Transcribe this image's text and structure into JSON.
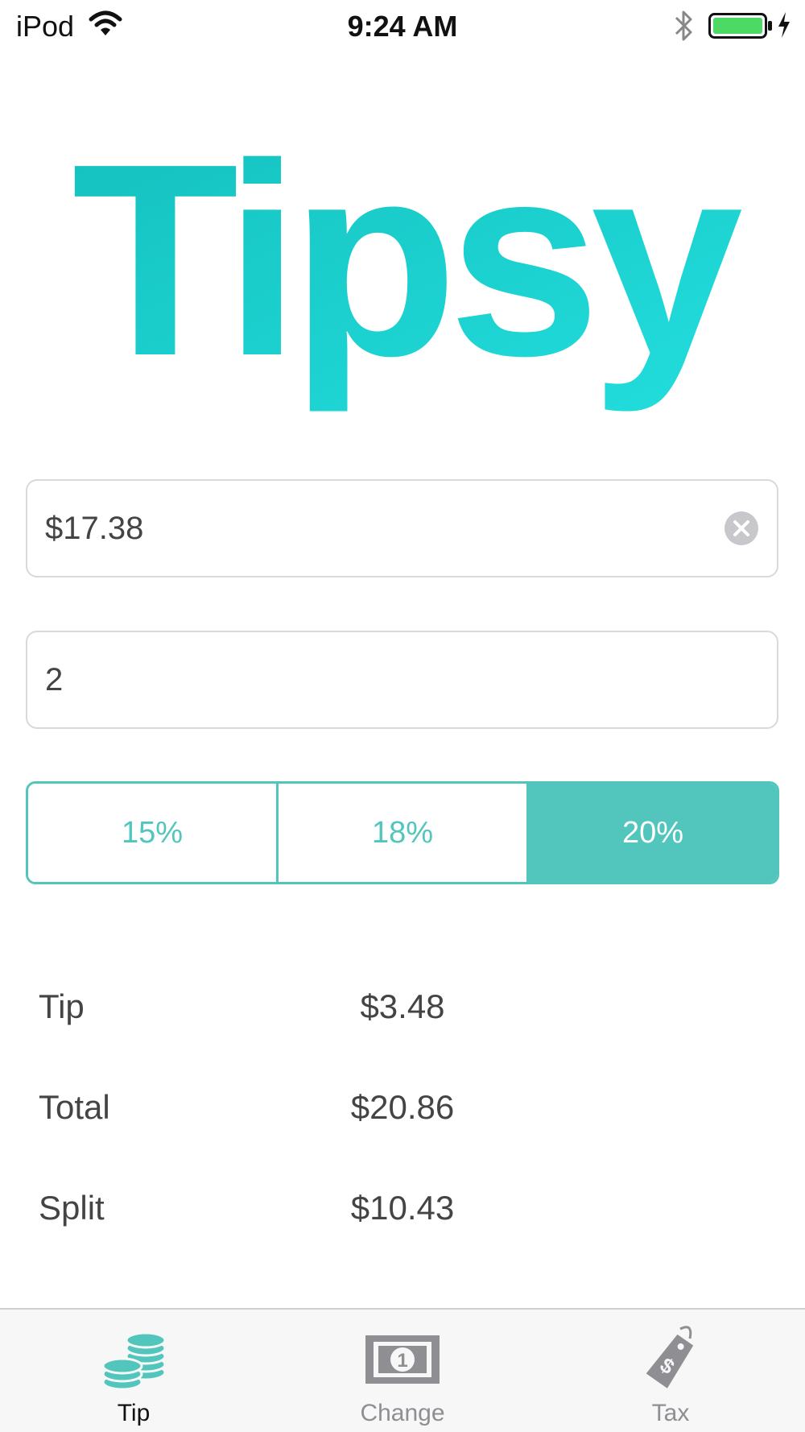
{
  "status_bar": {
    "carrier": "iPod",
    "time": "9:24 AM",
    "battery_color": "#4cd964"
  },
  "app": {
    "logo_text": "Tipsy",
    "logo_gradient": [
      "#14c0bd",
      "#22dede"
    ]
  },
  "bill_input": {
    "value": "$17.38",
    "has_clear_button": true
  },
  "split_input": {
    "value": "2"
  },
  "tip_selector": {
    "options": [
      "15%",
      "18%",
      "20%"
    ],
    "selected": "20%",
    "accent_color": "#52c6bd"
  },
  "results": [
    {
      "label": "Tip",
      "value": "$3.48"
    },
    {
      "label": "Total",
      "value": "$20.86"
    },
    {
      "label": "Split",
      "value": "$10.43"
    }
  ],
  "tab_bar": {
    "items": [
      {
        "label": "Tip",
        "icon": "coins-icon",
        "active": true
      },
      {
        "label": "Change",
        "icon": "dollar-bill-icon",
        "active": false
      },
      {
        "label": "Tax",
        "icon": "price-tag-icon",
        "active": false
      }
    ]
  }
}
